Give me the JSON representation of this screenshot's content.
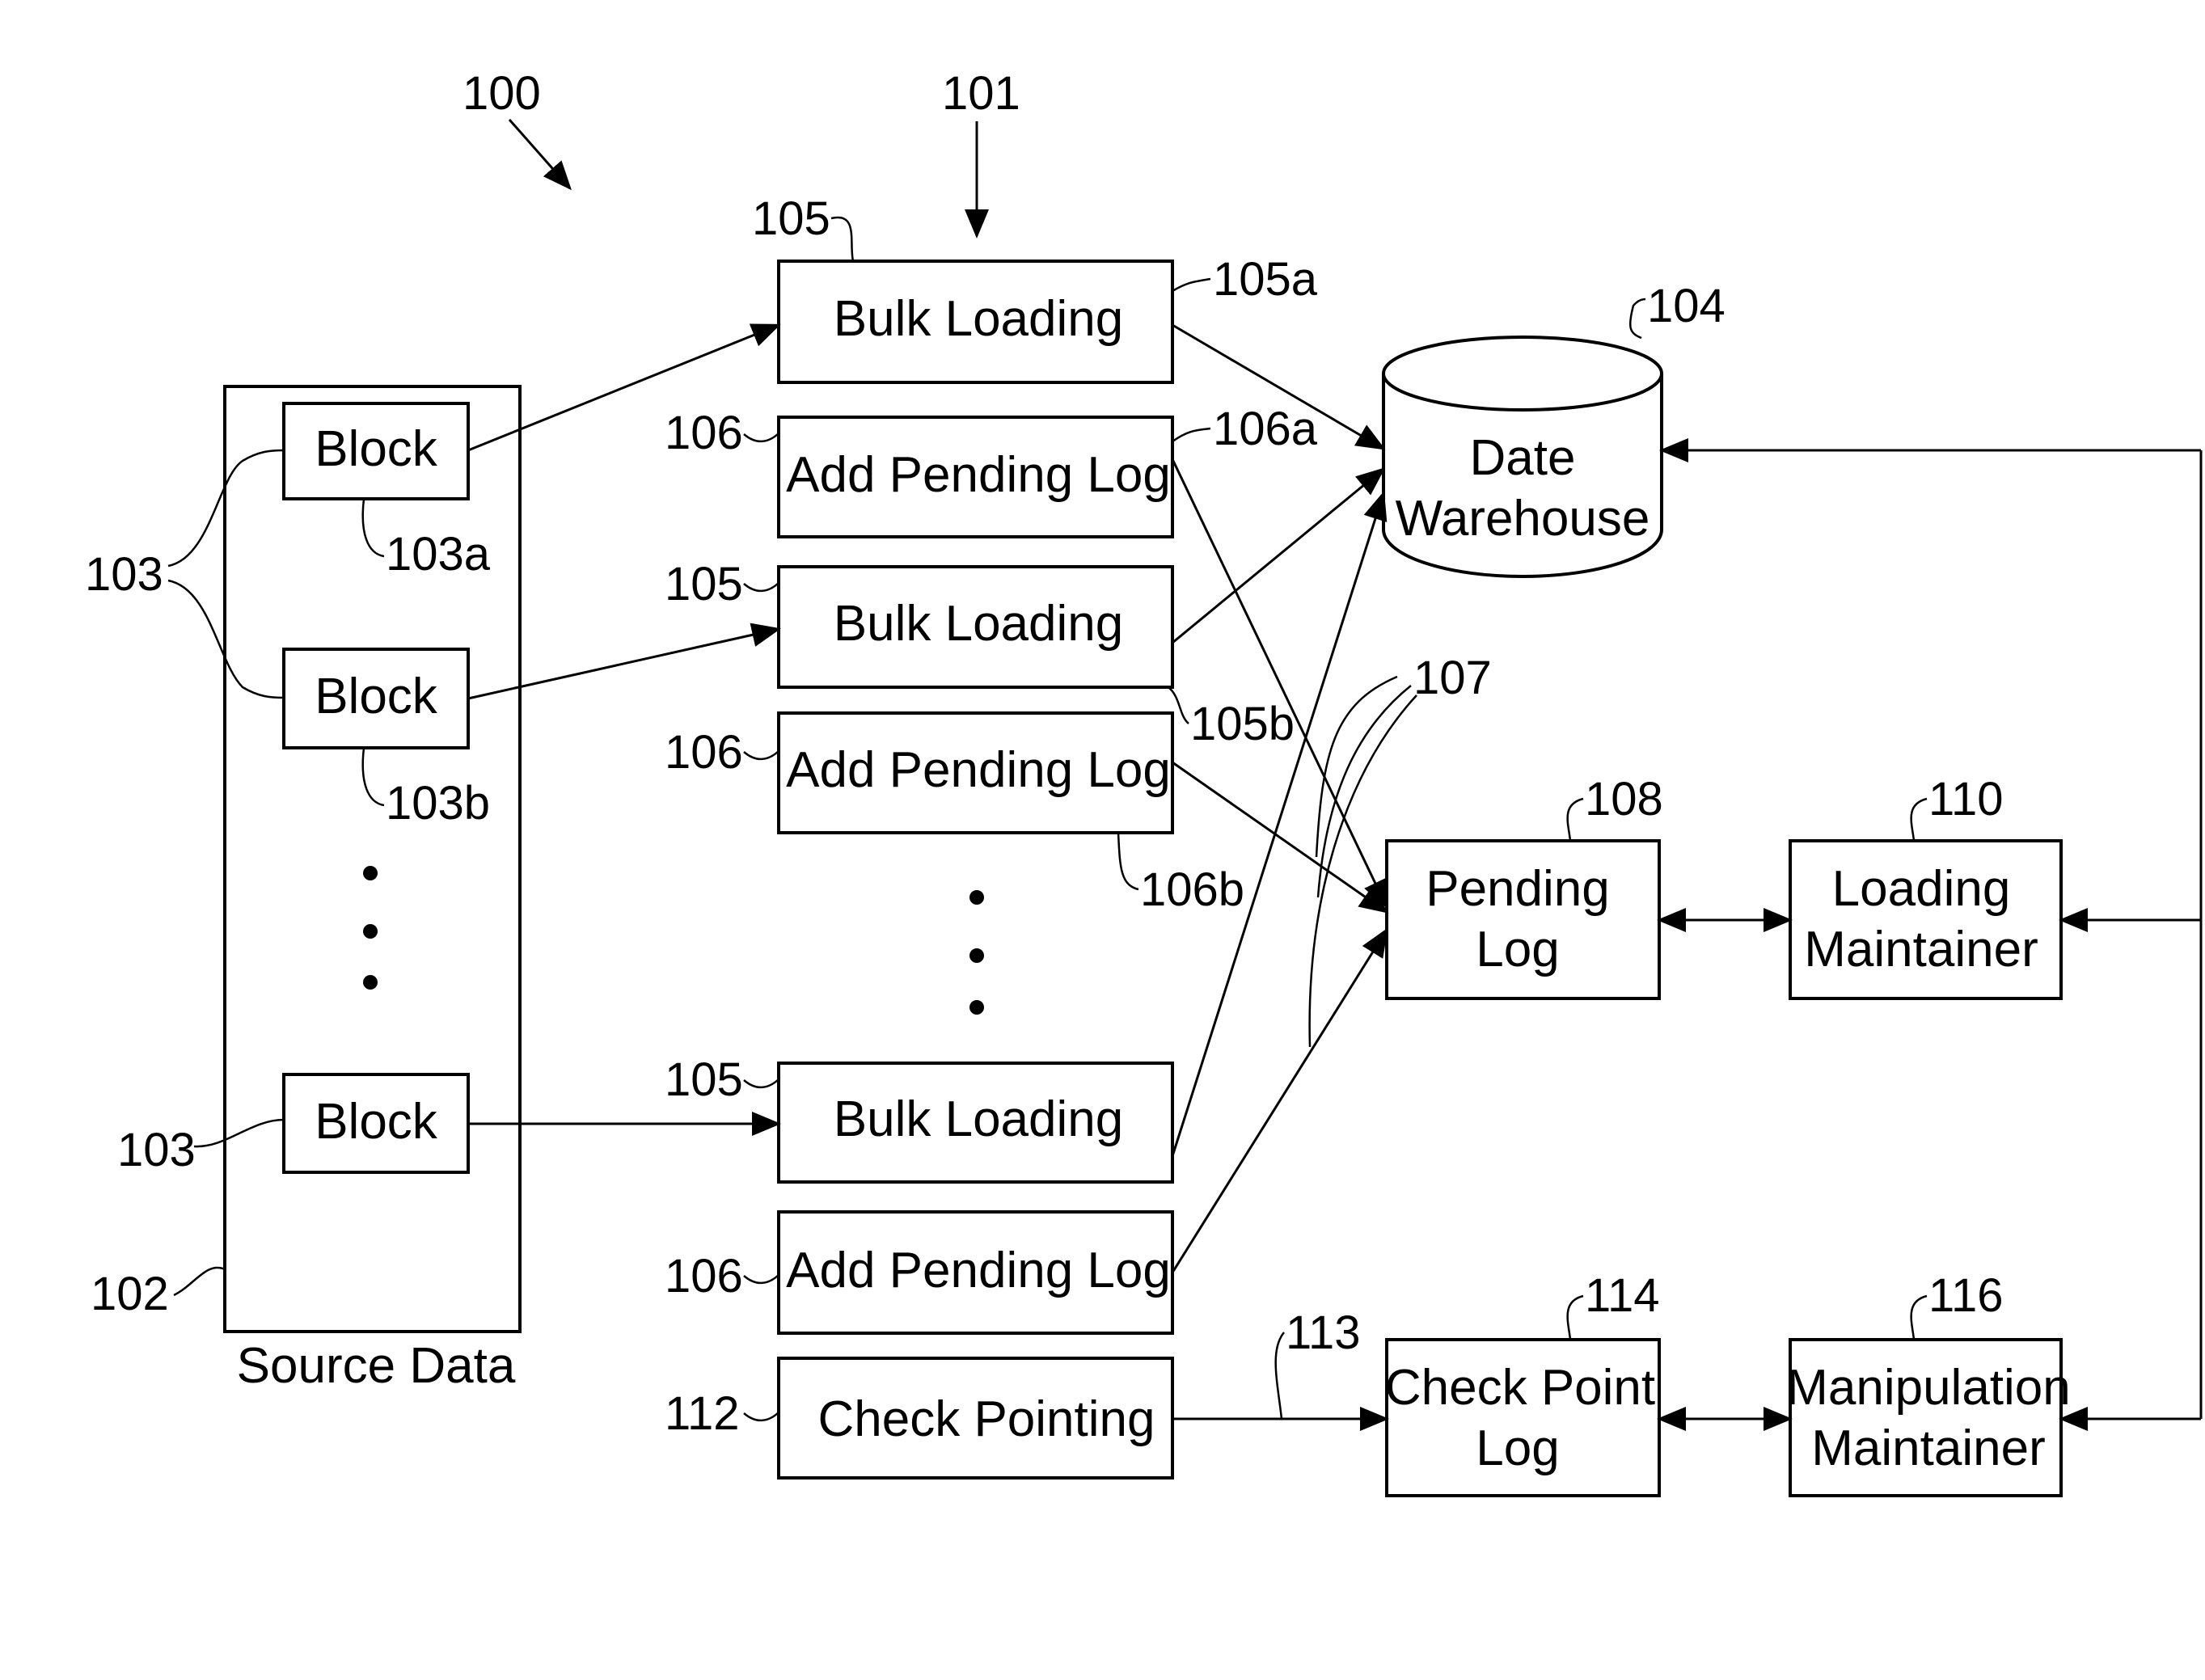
{
  "figure": {
    "ref_main": "100",
    "ref_process": "101"
  },
  "source_data": {
    "caption": "Source Data",
    "ref": "102",
    "blocks": [
      {
        "label": "Block",
        "ref": "103a"
      },
      {
        "label": "Block",
        "ref": "103b"
      },
      {
        "label": "Block",
        "ref": "103"
      }
    ],
    "group_ref": "103",
    "ellipsis": "•"
  },
  "processes": [
    {
      "label": "Bulk Loading",
      "ref_left": "105",
      "ref_right": "105a"
    },
    {
      "label": "Add Pending Log",
      "ref_left": "106",
      "ref_right": "106a"
    },
    {
      "label": "Bulk Loading",
      "ref_left": "105",
      "ref_right": "105b"
    },
    {
      "label": "Add Pending Log",
      "ref_left": "106",
      "ref_right": "106b"
    },
    {
      "label": "Bulk Loading",
      "ref_left": "105",
      "ref_right": ""
    },
    {
      "label": "Add Pending Log",
      "ref_left": "106",
      "ref_right": ""
    },
    {
      "label": "Check Pointing",
      "ref_left": "112",
      "ref_right": ""
    }
  ],
  "warehouse": {
    "line1": "Date",
    "line2": "Warehouse",
    "ref": "104"
  },
  "arrows_ref": "107",
  "checkpoint_arrow_ref": "113",
  "pending_log": {
    "line1": "Pending",
    "line2": "Log",
    "ref": "108"
  },
  "loading_maintainer": {
    "line1": "Loading",
    "line2": "Maintainer",
    "ref": "110"
  },
  "checkpoint_log": {
    "line1": "Check Point",
    "line2": "Log",
    "ref": "114"
  },
  "manipulation_maintainer": {
    "line1": "Manipulation",
    "line2": "Maintainer",
    "ref": "116"
  }
}
